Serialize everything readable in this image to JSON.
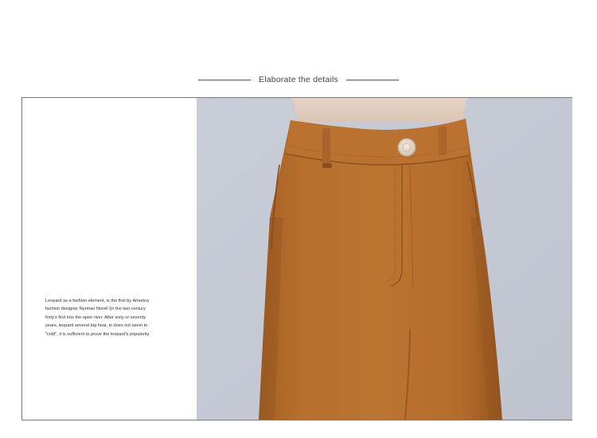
{
  "section": {
    "title": "Elaborate the details"
  },
  "description": {
    "lines": [
      "Leopard as a fashion element, is the first by America",
      "fashion designer Norman Norell (in the last century",
      "forty's first into the open river. After sixty or seventy",
      "years, leopard several big heat, in does not seem to",
      "\"cold\", it is sufficient to prove the leopard's popularity."
    ]
  },
  "photo": {
    "subject": "camel trousers waistband close-up",
    "colors": {
      "background": "#c6cbd6",
      "fabric": "#b46d2c",
      "fabric_shadow": "#8f5220",
      "skin": "#ead8cb",
      "button": "#e9dccd"
    }
  }
}
